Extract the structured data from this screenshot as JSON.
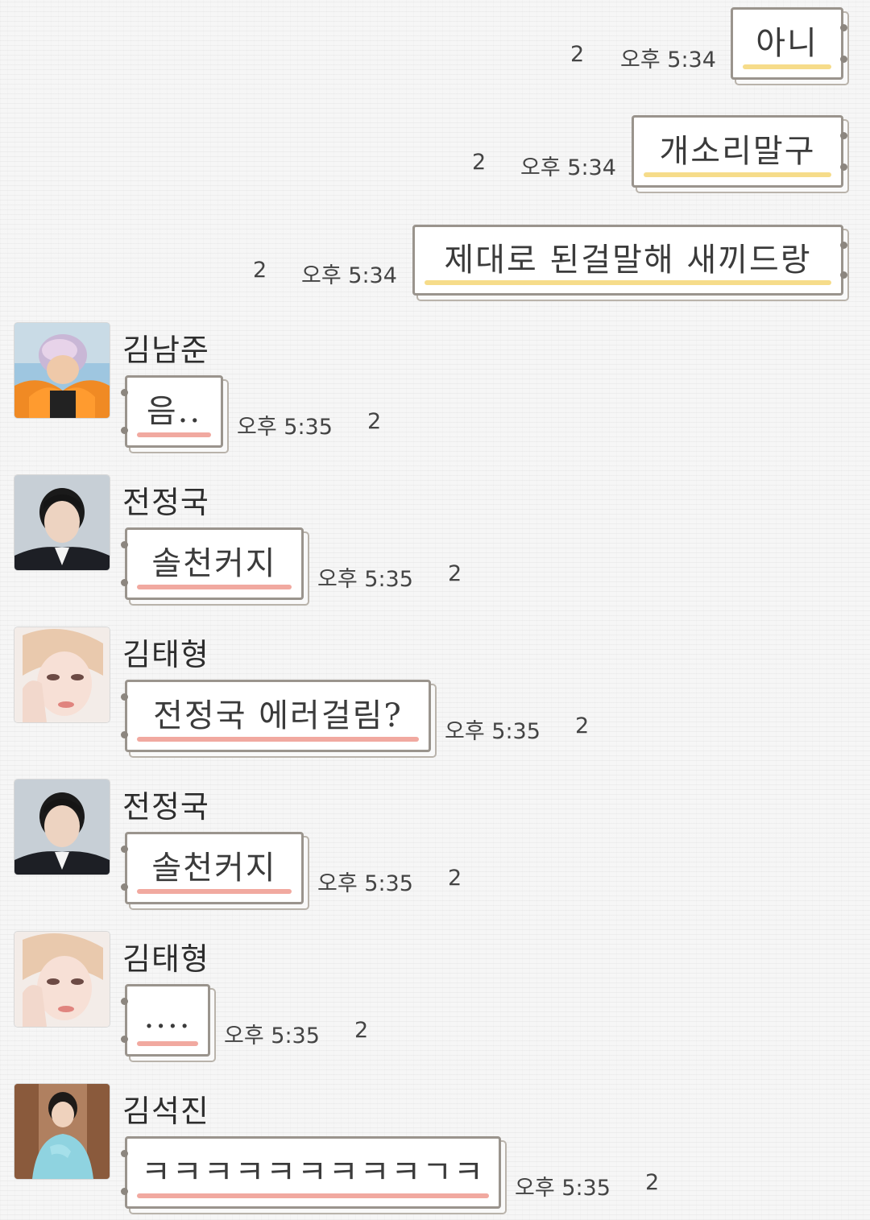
{
  "sent": [
    {
      "text": "아니",
      "time": "오후 5:34",
      "unread": "2"
    },
    {
      "text": "개소리말구",
      "time": "오후 5:34",
      "unread": "2"
    },
    {
      "text": "제대로 된걸말해 새끼드랑",
      "time": "오후 5:34",
      "unread": "2"
    }
  ],
  "received": [
    {
      "sender": "김남준",
      "avatar": "namjoon-avatar",
      "text": "음..",
      "time": "오후 5:35",
      "unread": "2"
    },
    {
      "sender": "전정국",
      "avatar": "jungkook-avatar",
      "text": "솔천커지",
      "time": "오후 5:35",
      "unread": "2"
    },
    {
      "sender": "김태형",
      "avatar": "taehyung-avatar",
      "text": "전정국 에러걸림?",
      "time": "오후 5:35",
      "unread": "2"
    },
    {
      "sender": "전정국",
      "avatar": "jungkook-avatar",
      "text": "솔천커지",
      "time": "오후 5:35",
      "unread": "2"
    },
    {
      "sender": "김태형",
      "avatar": "taehyung-avatar",
      "text": "....",
      "time": "오후 5:35",
      "unread": "2"
    },
    {
      "sender": "김석진",
      "avatar": "seokjin-avatar",
      "text": "ㅋㅋㅋㅋㅋㅋㅋㅋㅋㄱㅋ",
      "time": "오후 5:35",
      "unread": "2"
    }
  ],
  "colors": {
    "sent_underline": "#f6dc8a",
    "received_underline": "#f1a9a0",
    "bubble_border": "#9a948d",
    "background": "#f6f6f6"
  }
}
